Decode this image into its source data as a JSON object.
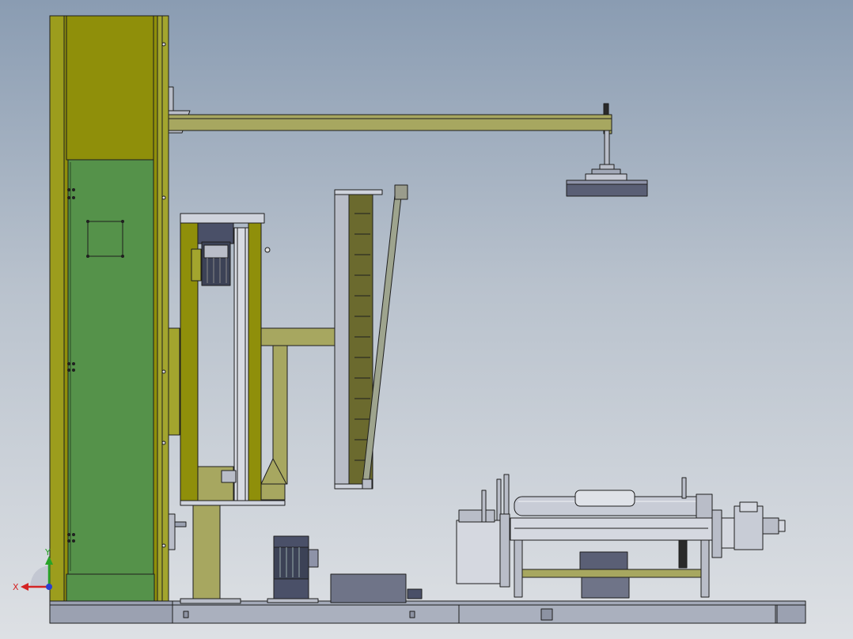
{
  "view": {
    "type": "CAD orthographic side view",
    "background_top": "#8a9cb2",
    "background_bottom": "#dde0e4"
  },
  "colors": {
    "frame_olive": "#8f8f0a",
    "frame_olive_light": "#a3a52e",
    "door_green": "#55924a",
    "beam_khaki": "#a7a760",
    "mast_dark_olive": "#6b6a2e",
    "steel_gray": "#b9bdc8",
    "motor_dark": "#3c4256",
    "outline": "#1e1e1e"
  },
  "triad": {
    "x_label": "X",
    "y_label": "Y",
    "x_color": "#d42424",
    "y_color": "#27a327",
    "z_color": "#2a3fd0"
  },
  "components": [
    "tower-column",
    "control-cabinet-door",
    "jib-arm",
    "pressure-disc",
    "lift-carriage",
    "lift-motor",
    "vertical-mast",
    "tension-rod",
    "base-motor",
    "roller-conveyor",
    "drive-gearbox",
    "base-platform"
  ]
}
